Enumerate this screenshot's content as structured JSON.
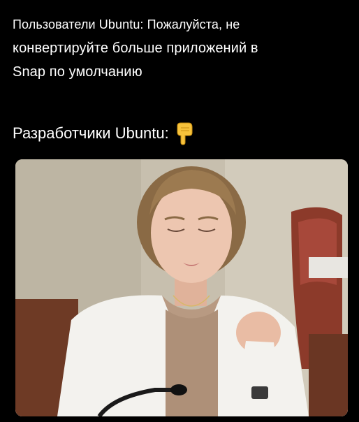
{
  "post": {
    "caption_lines": [
      "Пользователи Ubuntu: Пожалуйста, не",
      "конвертируйте больше приложений в",
      "Snap по умолчанию"
    ],
    "subtitle": "Разработчики Ubuntu:",
    "subtitle_icon": "pointing-down-hand-emoji",
    "image_subject": "woman-in-white-blazer-looking-at-hand"
  },
  "colors": {
    "background": "#000000",
    "text": "#ffffff",
    "emoji": "#f7c23b"
  }
}
